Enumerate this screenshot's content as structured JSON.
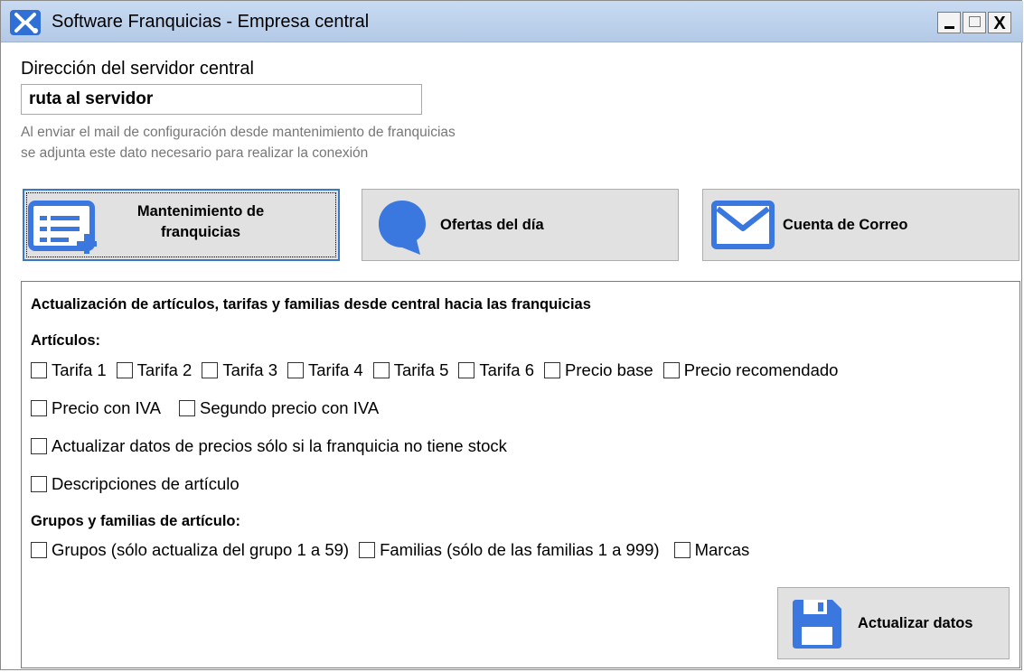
{
  "window": {
    "title": "Software Franquicias - Empresa central",
    "controls": {
      "minimize": "_",
      "maximize": "☐",
      "close": "X"
    }
  },
  "server": {
    "label": "Dirección del servidor central",
    "value": "ruta al servidor",
    "hint_line1": "Al enviar el mail de configuración desde mantenimiento de franquicias",
    "hint_line2": "se adjunta este dato necesario para realizar la conexión"
  },
  "buttons": {
    "mantenimiento": {
      "line1": "Mantenimiento de",
      "line2": "franquicias",
      "icon": "list-add-icon"
    },
    "ofertas": {
      "label": "Ofertas del día",
      "icon": "chat-bubble-icon"
    },
    "correo": {
      "label": "Cuenta de Correo",
      "icon": "mail-icon"
    }
  },
  "update_panel": {
    "heading": "Actualización de artículos, tarifas y familias desde central hacia las franquicias",
    "articulos_label": "Artículos:",
    "row1": [
      "Tarifa 1",
      "Tarifa 2",
      "Tarifa 3",
      "Tarifa 4",
      "Tarifa 5",
      "Tarifa 6",
      "Precio base",
      "Precio recomendado"
    ],
    "row2": [
      "Precio con IVA",
      "Segundo precio con IVA"
    ],
    "row3": [
      "Actualizar datos de precios sólo si la franquicia no tiene stock"
    ],
    "row4": [
      "Descripciones de artículo"
    ],
    "grupos_label": "Grupos y familias de artículo:",
    "row5": [
      "Grupos (sólo actualiza del grupo 1 a 59)",
      "Familias (sólo de las familias 1 a 999)",
      "Marcas"
    ],
    "update_button": {
      "label": "Actualizar datos",
      "icon": "floppy-disk-icon"
    }
  },
  "colors": {
    "accent": "#3a78e0",
    "button_bg": "#e1e1e1",
    "titlebar": "#c1d5ef"
  }
}
